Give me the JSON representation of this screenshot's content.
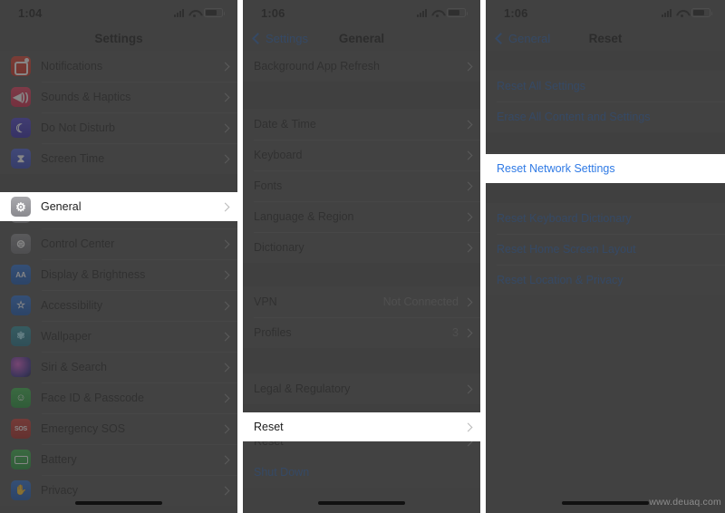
{
  "watermark": "www.deuaq.com",
  "panels": [
    {
      "id": "settings",
      "status": {
        "time": "1:04"
      },
      "nav": {
        "title": "Settings",
        "back": null
      },
      "groups": [
        {
          "rows": [
            {
              "label": "Notifications",
              "icon": "notifications-icon",
              "chevron": true
            },
            {
              "label": "Sounds & Haptics",
              "icon": "sounds-haptics-icon",
              "chevron": true
            },
            {
              "label": "Do Not Disturb",
              "icon": "do-not-disturb-icon",
              "chevron": true
            },
            {
              "label": "Screen Time",
              "icon": "screen-time-icon",
              "chevron": true
            }
          ]
        },
        {
          "rows": [
            {
              "label": "General",
              "icon": "general-gear-icon",
              "chevron": true,
              "highlight": true
            },
            {
              "label": "Control Center",
              "icon": "control-center-icon",
              "chevron": true
            },
            {
              "label": "Display & Brightness",
              "icon": "display-brightness-icon",
              "chevron": true
            },
            {
              "label": "Accessibility",
              "icon": "accessibility-icon",
              "chevron": true
            },
            {
              "label": "Wallpaper",
              "icon": "wallpaper-icon",
              "chevron": true
            },
            {
              "label": "Siri & Search",
              "icon": "siri-search-icon",
              "chevron": true
            },
            {
              "label": "Face ID & Passcode",
              "icon": "face-id-icon",
              "chevron": true
            },
            {
              "label": "Emergency SOS",
              "icon": "emergency-sos-icon",
              "chevron": true
            },
            {
              "label": "Battery",
              "icon": "battery-icon",
              "chevron": true
            },
            {
              "label": "Privacy",
              "icon": "privacy-icon",
              "chevron": true
            }
          ]
        }
      ]
    },
    {
      "id": "general",
      "status": {
        "time": "1:06"
      },
      "nav": {
        "title": "General",
        "back": "Settings"
      },
      "groups": [
        {
          "rows": [
            {
              "label": "Background App Refresh",
              "chevron": true
            }
          ]
        },
        {
          "rows": [
            {
              "label": "Date & Time",
              "chevron": true
            },
            {
              "label": "Keyboard",
              "chevron": true
            },
            {
              "label": "Fonts",
              "chevron": true
            },
            {
              "label": "Language & Region",
              "chevron": true
            },
            {
              "label": "Dictionary",
              "chevron": true
            }
          ]
        },
        {
          "rows": [
            {
              "label": "VPN",
              "value": "Not Connected",
              "chevron": true
            },
            {
              "label": "Profiles",
              "value": "3",
              "chevron": true
            }
          ]
        },
        {
          "rows": [
            {
              "label": "Legal & Regulatory",
              "chevron": true
            }
          ]
        },
        {
          "rows": [
            {
              "label": "Reset",
              "chevron": true,
              "highlight": true
            }
          ]
        },
        {
          "rows": [
            {
              "label": "Shut Down",
              "blue": true,
              "chevron": false
            }
          ]
        }
      ]
    },
    {
      "id": "reset",
      "status": {
        "time": "1:06"
      },
      "nav": {
        "title": "Reset",
        "back": "General"
      },
      "groups": [
        {
          "rows": [
            {
              "label": "Reset All Settings",
              "blue": true,
              "chevron": false
            },
            {
              "label": "Erase All Content and Settings",
              "blue": true,
              "chevron": false
            }
          ]
        },
        {
          "rows": [
            {
              "label": "Reset Network Settings",
              "blue": true,
              "chevron": false,
              "highlight": true
            }
          ]
        },
        {
          "rows": [
            {
              "label": "Reset Keyboard Dictionary",
              "blue": true,
              "chevron": false
            },
            {
              "label": "Reset Home Screen Layout",
              "blue": true,
              "chevron": false
            },
            {
              "label": "Reset Location & Privacy",
              "blue": true,
              "chevron": false
            }
          ]
        }
      ]
    }
  ],
  "colors": {
    "accent_blue": "#2f7ae5",
    "nav_blue": "#2a5fa8",
    "panel_bg": "#4e4e4e",
    "gap_bg": "#474747",
    "highlight_bg": "#ffffff"
  }
}
